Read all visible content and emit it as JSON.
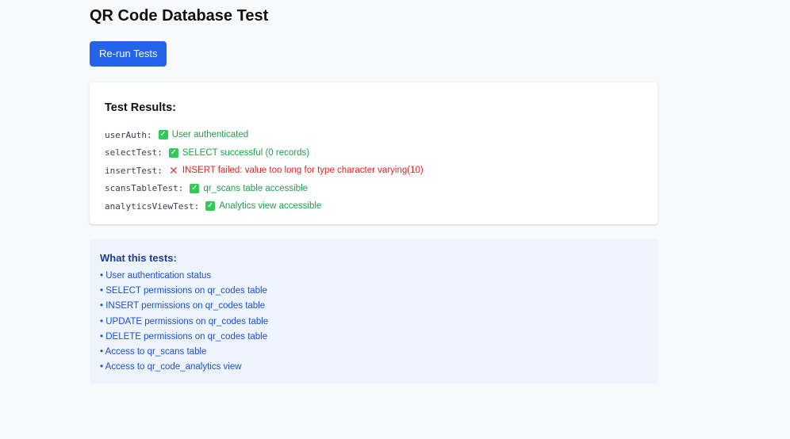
{
  "page": {
    "title": "QR Code Database Test"
  },
  "actions": {
    "rerun_label": "Re-run Tests"
  },
  "results": {
    "heading": "Test Results:",
    "items": [
      {
        "key": "userAuth:",
        "status": "ok",
        "icon": "check-icon",
        "message": "User authenticated"
      },
      {
        "key": "selectTest:",
        "status": "ok",
        "icon": "check-icon",
        "message": "SELECT successful (0 records)"
      },
      {
        "key": "insertTest:",
        "status": "fail",
        "icon": "cross-icon",
        "message": "INSERT failed: value too long for type character varying(10)"
      },
      {
        "key": "scansTableTest:",
        "status": "ok",
        "icon": "check-icon",
        "message": "qr_scans table accessible"
      },
      {
        "key": "analyticsViewTest:",
        "status": "ok",
        "icon": "check-icon",
        "message": "Analytics view accessible"
      }
    ]
  },
  "info": {
    "heading": "What this tests:",
    "items": [
      "• User authentication status",
      "• SELECT permissions on qr_codes table",
      "• INSERT permissions on qr_codes table",
      "• UPDATE permissions on qr_codes table",
      "• DELETE permissions on qr_codes table",
      "• Access to qr_scans table",
      "• Access to qr_code_analytics view"
    ]
  },
  "colors": {
    "accent": "#2563eb",
    "success": "#16a34a",
    "error": "#dc2626",
    "info_bg": "#eef4fd",
    "info_text": "#1d4ed8"
  }
}
